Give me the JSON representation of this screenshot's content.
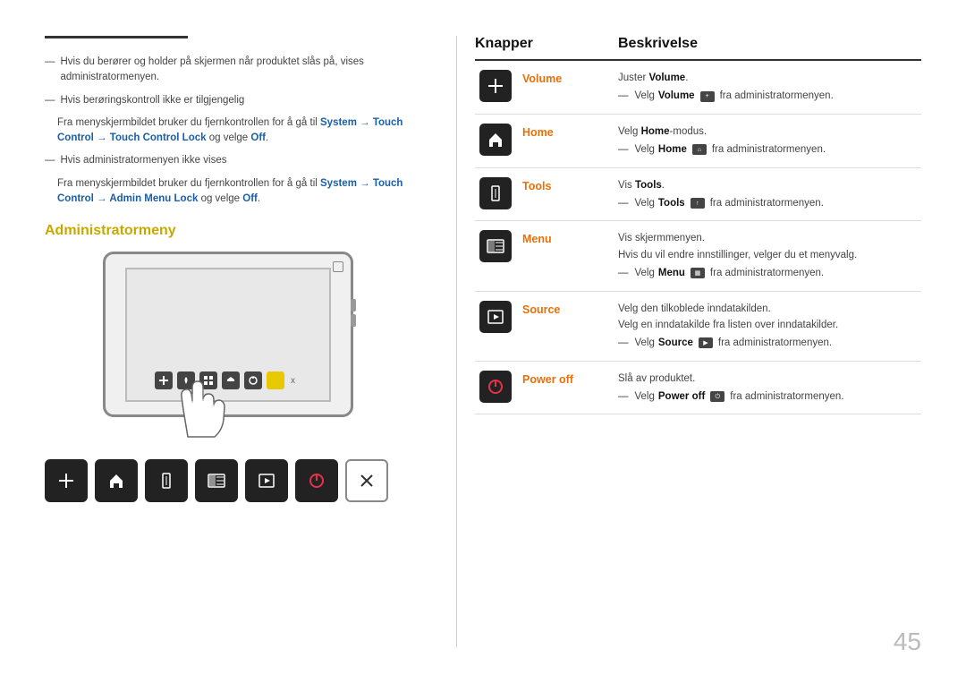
{
  "left": {
    "bullet1": {
      "text": "Hvis du berører og holder på skjermen når produktet slås på, vises administratormenyen."
    },
    "bullet2": {
      "dash": "—",
      "text": "Hvis berøringskontroll ikke er tilgjengelig"
    },
    "bullet2_detail": {
      "prefix": "Fra menyskjermbildet bruker du fjernkontrollen for å gå til ",
      "link1": "System → Touch Control → Touch Control Lock",
      "suffix": " og velge ",
      "link2": "Off",
      "end": "."
    },
    "bullet3": {
      "dash": "—",
      "text": "Hvis administratormenyen ikke vises"
    },
    "bullet3_detail": {
      "prefix": "Fra menyskjermbildet bruker du fjernkontrollen for å gå til ",
      "link1": "System → Touch Control → Admin Menu Lock",
      "suffix": " og velge ",
      "link2": "Off",
      "end": "."
    },
    "section_title": "Administratormeny"
  },
  "right": {
    "col1_label": "Knapper",
    "col2_label": "Beskrivelse",
    "rows": [
      {
        "icon": "+",
        "name": "Volume",
        "desc_line1": "Juster ",
        "desc_bold1": "Volume",
        "desc_sub": "Velg ",
        "desc_bold2": "Volume",
        "desc_suffix": " fra administratormenyen."
      },
      {
        "icon": "🏠",
        "name": "Home",
        "desc_line1": "Velg ",
        "desc_bold1": "Home",
        "desc_suffix1": "-modus.",
        "desc_sub": "Velg ",
        "desc_bold2": "Home",
        "desc_suffix": " fra administratormenyen."
      },
      {
        "icon": "⬆",
        "name": "Tools",
        "desc_line1": "Vis ",
        "desc_bold1": "Tools",
        "desc_suffix1": ".",
        "desc_sub": "Velg ",
        "desc_bold2": "Tools",
        "desc_suffix": " fra administratormenyen."
      },
      {
        "icon": "▦",
        "name": "Menu",
        "desc_line1": "Vis skjermmenyen.",
        "desc_line2": "Hvis du vil endre innstillinger, velger du et menyvalg.",
        "desc_sub": "Velg ",
        "desc_bold2": "Menu",
        "desc_suffix": " fra administratormenyen."
      },
      {
        "icon": "⬛",
        "name": "Source",
        "desc_line1": "Velg den tilkoblede inndatakilden.",
        "desc_line2": "Velg en inndatakilde fra listen over inndatakilder.",
        "desc_sub": "Velg ",
        "desc_bold2": "Source",
        "desc_suffix": " fra administratormenyen."
      },
      {
        "icon": "⏻",
        "name": "Power off",
        "desc_line1": "Slå av produktet.",
        "desc_sub": "Velg ",
        "desc_bold2": "Power off",
        "desc_suffix": " fra administratormenyen.",
        "is_power": true
      }
    ]
  },
  "page_number": "45"
}
